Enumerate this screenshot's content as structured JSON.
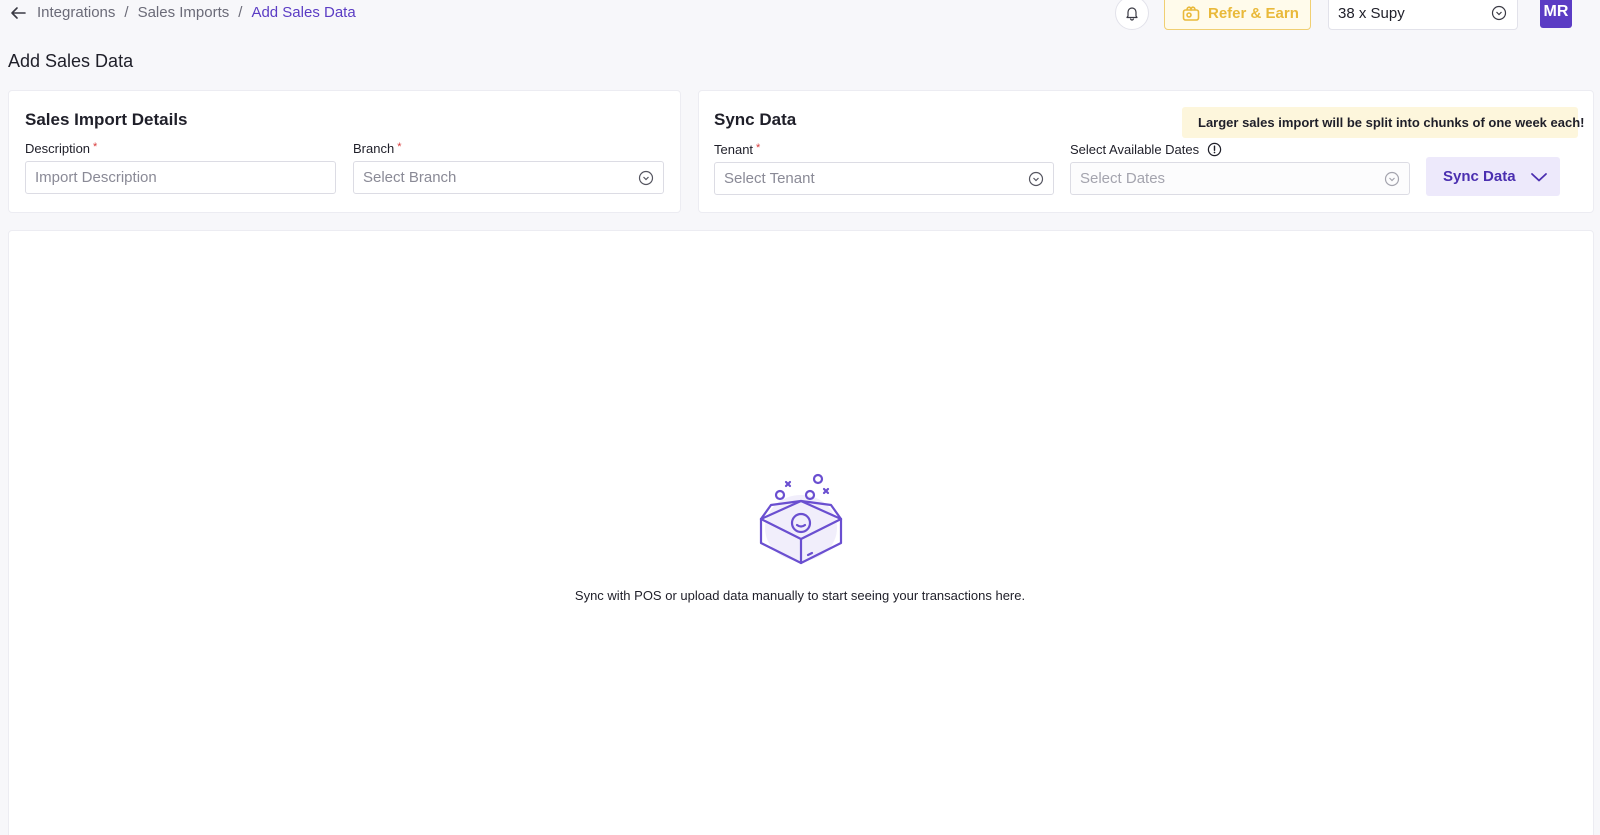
{
  "breadcrumb": {
    "items": [
      "Integrations",
      "Sales Imports"
    ],
    "current": "Add Sales Data",
    "separator": "/"
  },
  "header": {
    "refer_label": "Refer & Earn",
    "org_selected": "38 x Supy",
    "avatar_initials": "MR"
  },
  "page": {
    "title": "Add Sales Data"
  },
  "import_details": {
    "title": "Sales Import Details",
    "description_label": "Description",
    "description_placeholder": "Import Description",
    "branch_label": "Branch",
    "branch_placeholder": "Select Branch",
    "required_mark": "*"
  },
  "sync": {
    "title": "Sync Data",
    "banner_text": "Larger sales import will be split into chunks of one week each!",
    "tenant_label": "Tenant",
    "tenant_placeholder": "Select Tenant",
    "dates_label": "Select Available Dates",
    "dates_placeholder": "Select Dates",
    "button_label": "Sync Data"
  },
  "empty_state": {
    "message": "Sync with POS or upload data manually to start seeing your transactions here."
  },
  "colors": {
    "brand": "#5b3cc4",
    "refer": "#e9b93a",
    "banner_bg": "#fdf6dc",
    "required": "#d83a3a"
  }
}
